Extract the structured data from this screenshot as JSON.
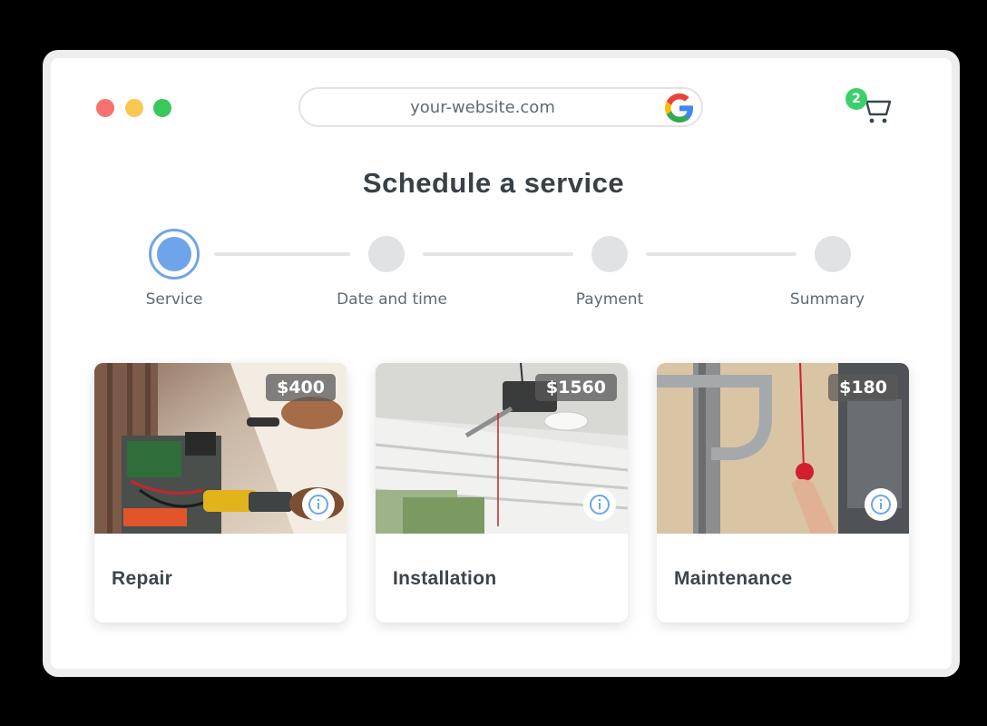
{
  "window": {
    "controls": {
      "close_color": "#f87171",
      "minimize_color": "#f9c851",
      "maximize_color": "#3cc75a"
    }
  },
  "browser": {
    "url": "your-website.com",
    "search_engine_icon": "google-icon"
  },
  "cart": {
    "icon": "cart-icon",
    "count": "2",
    "badge_color": "#3ccf6e"
  },
  "page": {
    "title": "Schedule a service"
  },
  "steps": [
    {
      "label": "Service",
      "active": true
    },
    {
      "label": "Date and time",
      "active": false
    },
    {
      "label": "Payment",
      "active": false
    },
    {
      "label": "Summary",
      "active": false
    }
  ],
  "accent_color": "#6ea5ea",
  "services": [
    {
      "name": "Repair",
      "price": "$400",
      "image": "repair-photo",
      "info_icon": "info-icon"
    },
    {
      "name": "Installation",
      "price": "$1560",
      "image": "installation-photo",
      "info_icon": "info-icon"
    },
    {
      "name": "Maintenance",
      "price": "$180",
      "image": "maintenance-photo",
      "info_icon": "info-icon"
    }
  ]
}
